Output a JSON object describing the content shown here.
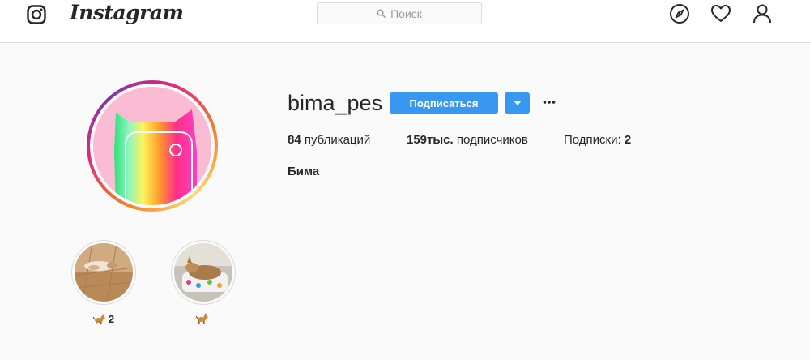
{
  "app": {
    "logo_icon": "instagram-camera-icon",
    "wordmark": "Instagram"
  },
  "search": {
    "placeholder": "Поиск",
    "icon": "search-icon"
  },
  "nav": {
    "icons": [
      "compass-icon",
      "heart-icon",
      "user-icon"
    ]
  },
  "profile": {
    "username": "bima_pes",
    "follow_label": "Подписаться",
    "dropdown_icon": "chevron-down-icon",
    "more_icon": "more-icon",
    "posts": {
      "value": "84",
      "label": "публикаций"
    },
    "followers": {
      "value": "159тыс.",
      "label": "подписчиков"
    },
    "following": {
      "label": "Подписки:",
      "value": "2"
    },
    "full_name": "Бима"
  },
  "highlights": [
    {
      "emoji_icon": "dog-icon",
      "label": "2"
    },
    {
      "emoji_icon": "dog-icon",
      "label": ""
    }
  ],
  "colors": {
    "accent": "#3897f0",
    "text": "#262626",
    "border": "#dbdbdb",
    "avatar_bg": "#f9bcd2"
  }
}
